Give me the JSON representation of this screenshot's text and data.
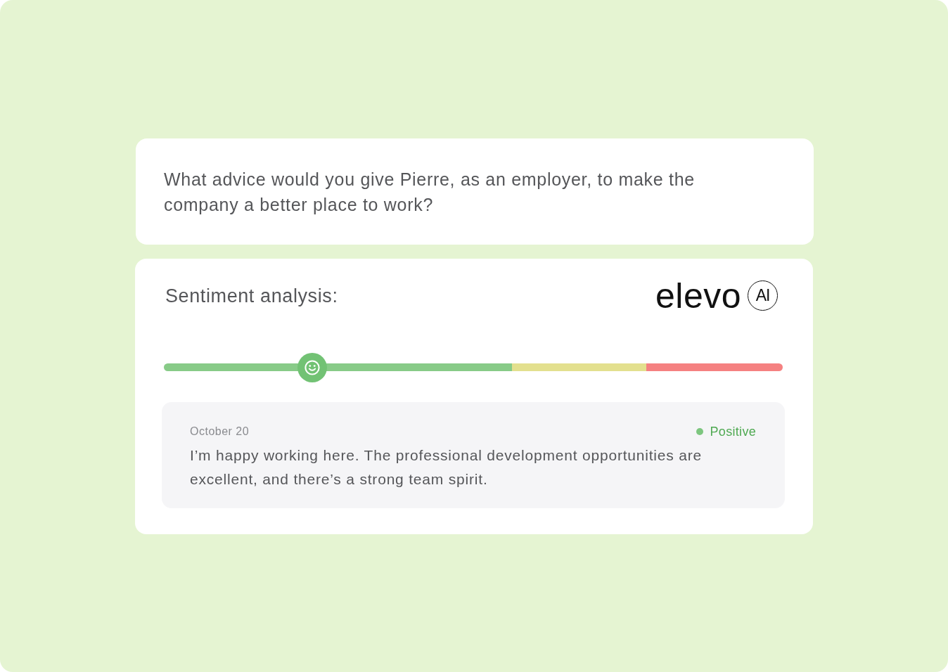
{
  "question": {
    "text": "What advice would you give Pierre, as an employer, to make the company a better place to work?"
  },
  "sentiment_panel": {
    "title": "Sentiment analysis:",
    "logo": {
      "wordmark": "elevo",
      "badge": "AI"
    },
    "scale": {
      "level": 0.24
    },
    "review": {
      "date": "October 20",
      "sentiment": {
        "label": "Positive",
        "color": "#7dc67f"
      },
      "text": "I’m happy working here. The professional development opportunities are excellent, and there’s a strong team spirit."
    }
  }
}
